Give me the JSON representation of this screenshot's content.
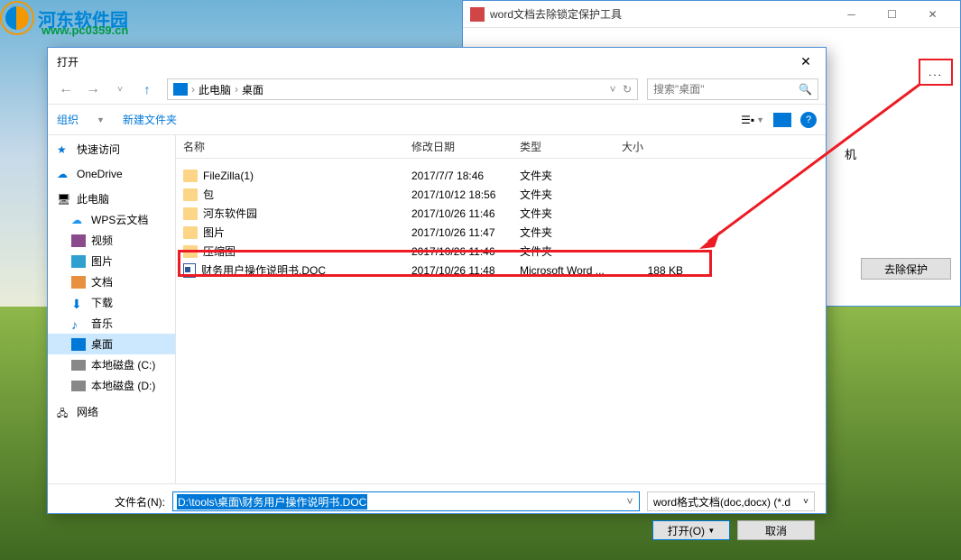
{
  "watermark": {
    "name": "河东软件园",
    "url": "www.pc0359.cn"
  },
  "tool": {
    "title": "word文档去除锁定保护工具",
    "browse": "...",
    "side_label": "机",
    "remove_btn": "去除保护"
  },
  "dialog": {
    "title": "打开",
    "breadcrumb": {
      "pc": "此电脑",
      "desktop": "桌面"
    },
    "search_placeholder": "搜索\"桌面\"",
    "toolbar": {
      "organize": "组织",
      "newfolder": "新建文件夹"
    },
    "headers": {
      "name": "名称",
      "date": "修改日期",
      "type": "类型",
      "size": "大小"
    },
    "sidebar": {
      "quick": "快速访问",
      "onedrive": "OneDrive",
      "thispc": "此电脑",
      "wps": "WPS云文档",
      "video": "视频",
      "pictures": "图片",
      "documents": "文档",
      "downloads": "下载",
      "music": "音乐",
      "desktop": "桌面",
      "diskC": "本地磁盘 (C:)",
      "diskD": "本地磁盘 (D:)",
      "network": "网络"
    },
    "files": [
      {
        "name": "FileZilla(1)",
        "date": "2017/7/7 18:46",
        "type": "文件夹",
        "size": "",
        "icon": "folder"
      },
      {
        "name": "包",
        "date": "2017/10/12 18:56",
        "type": "文件夹",
        "size": "",
        "icon": "folder"
      },
      {
        "name": "河东软件园",
        "date": "2017/10/26 11:46",
        "type": "文件夹",
        "size": "",
        "icon": "folder"
      },
      {
        "name": "图片",
        "date": "2017/10/26 11:47",
        "type": "文件夹",
        "size": "",
        "icon": "folder"
      },
      {
        "name": "压缩图",
        "date": "2017/10/26 11:46",
        "type": "文件夹",
        "size": "",
        "icon": "folder"
      },
      {
        "name": "财务用户操作说明书.DOC",
        "date": "2017/10/26 11:48",
        "type": "Microsoft Word ...",
        "size": "188 KB",
        "icon": "doc"
      }
    ],
    "filename_label": "文件名(N):",
    "filename_value": "D:\\tools\\桌面\\财务用户操作说明书.DOC",
    "filter": "word格式文档(doc,docx) (*.d",
    "open_btn": "打开(O)",
    "cancel_btn": "取消"
  }
}
